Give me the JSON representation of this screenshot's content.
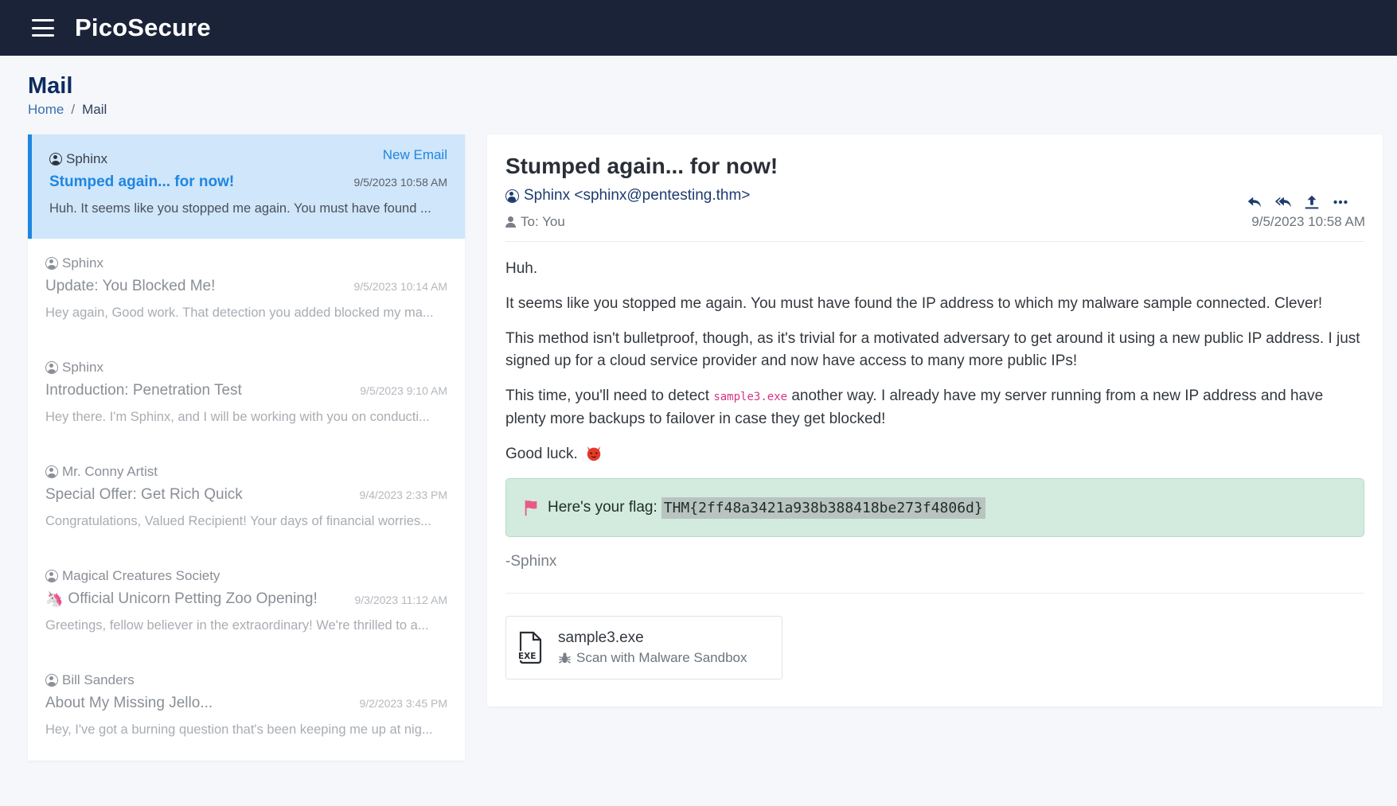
{
  "app": {
    "brand": "PicoSecure"
  },
  "page": {
    "title": "Mail",
    "breadcrumb": {
      "home": "Home",
      "separator": "/",
      "current": "Mail"
    }
  },
  "mail_list": [
    {
      "sender": "Sphinx",
      "badge": "New Email",
      "subject": "Stumped again... for now!",
      "time": "9/5/2023 10:58 AM",
      "preview": "Huh. It seems like you stopped me again. You must have found ...",
      "active": true
    },
    {
      "sender": "Sphinx",
      "subject": "Update: You Blocked Me!",
      "time": "9/5/2023 10:14 AM",
      "preview": "Hey again, Good work. That detection you added blocked my ma..."
    },
    {
      "sender": "Sphinx",
      "subject": "Introduction: Penetration Test",
      "time": "9/5/2023 9:10 AM",
      "preview": "Hey there. I'm Sphinx, and I will be working with you on conducti..."
    },
    {
      "sender": "Mr. Conny Artist",
      "subject": "Special Offer: Get Rich Quick",
      "time": "9/4/2023 2:33 PM",
      "preview": "Congratulations, Valued Recipient! Your days of financial worries..."
    },
    {
      "sender": "Magical Creatures Society",
      "subject_icon": "🦄",
      "subject": "Official Unicorn Petting Zoo Opening!",
      "time": "9/3/2023 11:12 AM",
      "preview": "Greetings, fellow believer in the extraordinary! We're thrilled to a..."
    },
    {
      "sender": "Bill Sanders",
      "subject": "About My Missing Jello...",
      "time": "9/2/2023 3:45 PM",
      "preview": "Hey, I've got a burning question that's been keeping me up at nig..."
    }
  ],
  "reader": {
    "subject": "Stumped again... for now!",
    "from": "Sphinx <sphinx@pentesting.thm>",
    "to": "To: You",
    "date": "9/5/2023 10:58 AM",
    "actions": [
      "reply-icon",
      "reply-all-icon",
      "forward-icon",
      "more-icon"
    ],
    "body": {
      "p1": "Huh.",
      "p2": "It seems like you stopped me again. You must have found the IP address to which my malware sample connected. Clever!",
      "p3": "This method isn't bulletproof, though, as it's trivial for a motivated adversary to get around it using a new public IP address. I just signed up for a cloud service provider and now have access to many more public IPs!",
      "p4_before": "This time, you'll need to detect ",
      "p4_code": "sample3.exe",
      "p4_after": " another way. I already have my server running from a new IP address and have plenty more backups to failover in case they get blocked!",
      "p5": "Good luck."
    },
    "flag": {
      "label": "Here's your flag:",
      "value": "THM{2ff48a3421a938b388418be273f4806d}"
    },
    "signature": "-Sphinx",
    "attachment": {
      "name": "sample3.exe",
      "icon_label": "EXE",
      "action": "Scan with Malware Sandbox"
    }
  },
  "colors": {
    "topbar": "#1b2339",
    "accent": "#1f86e0",
    "active_item_bg": "#cfe6fb",
    "flag_bg": "#d2ebde",
    "page_bg": "#f5f7fb"
  }
}
